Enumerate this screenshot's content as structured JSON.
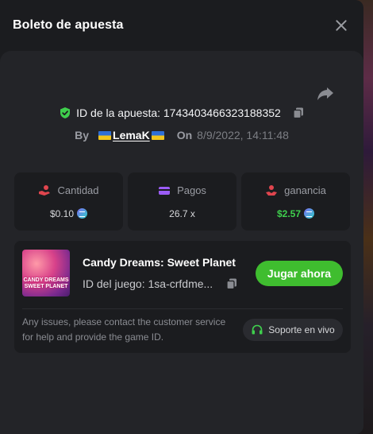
{
  "modal": {
    "title": "Boleto de apuesta"
  },
  "bet": {
    "id_text": "ID de la apuesta: 1743403466323188352",
    "by_label": "By",
    "user": "LemaK",
    "on_label": "On",
    "date": "8/9/2022, 14:11:48"
  },
  "stats": {
    "amount": {
      "label": "Cantidad",
      "value": "$0.10",
      "icon": "money-hand-icon",
      "color": "#e0454e"
    },
    "payout": {
      "label": "Pagos",
      "value": "26.7 x",
      "icon": "card-icon",
      "color": "#9b5cf6"
    },
    "profit": {
      "label": "ganancia",
      "value": "$2.57",
      "icon": "profit-hand-icon",
      "color": "#e0454e",
      "value_color": "#3fcf4d"
    }
  },
  "game": {
    "thumb_text_line1": "CANDY DREAMS",
    "thumb_text_line2": "SWEET PLANET",
    "name": "Candy Dreams: Sweet Planet",
    "id_text": "ID del juego: 1sa-crfdme...",
    "play_label": "Jugar ahora",
    "help_text": "Any issues, please contact the customer service for help and provide the game ID.",
    "support_label": "Soporte en vivo"
  },
  "colors": {
    "accent_green": "#3fbd2f",
    "panel": "#232428",
    "card": "#1b1c1f"
  }
}
